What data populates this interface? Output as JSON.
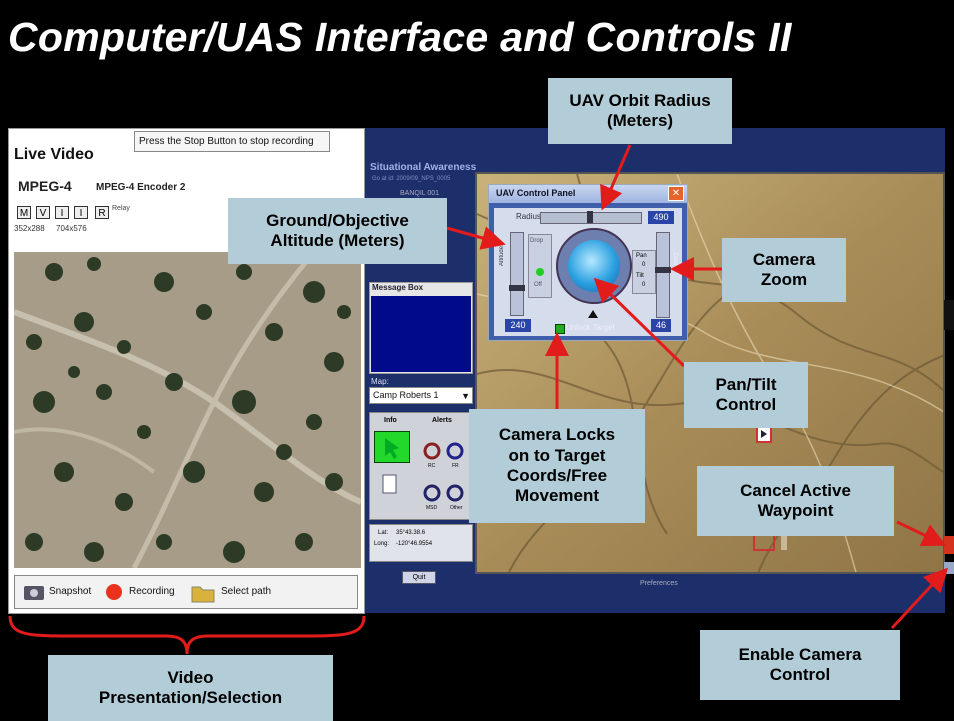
{
  "slide": {
    "title": "Computer/UAS Interface and Controls II"
  },
  "video_panel": {
    "tooltip": "Press the Stop Button to stop recording",
    "title": "Live Video",
    "codec": "MPEG-4",
    "encoder": "MPEG-4 Encoder 2",
    "mode_buttons": [
      "M",
      "V",
      "I",
      "I",
      "R"
    ],
    "relay_label": "Relay",
    "resolutions": [
      "352x288",
      "704x576"
    ],
    "controls": {
      "snapshot_label": "Snapshot",
      "recording_label": "Recording",
      "select_path_label": "Select path"
    }
  },
  "situational_awareness": {
    "title": "Situational Awareness",
    "subtitle": "Go at id: 2009/09_NPS_0005",
    "sub2": "BANQIL 001",
    "message_box_title": "Message Box",
    "map_label": "Map:",
    "map_selected": "Camp Roberts 1",
    "info_tab": "Info",
    "alerts_tab": "Alerts",
    "alert_labels": [
      "RC",
      "FR",
      "MSD",
      "Other"
    ],
    "lat_label": "Lat:",
    "lat_value": "35°43.38.6",
    "long_label": "Long:",
    "long_value": "-120°46.9554",
    "quit_label": "Quit",
    "preferences_label": "Preferences"
  },
  "uav_control_panel": {
    "title": "UAV Control Panel",
    "radius_label": "Radius",
    "radius_value": "490",
    "altitude_label": "Altitude",
    "altitude_value": "240",
    "drop_label": "Drop",
    "drop_state": "Off",
    "pan_label": "Pan",
    "tilt_label": "Tilt",
    "pan_value": "0",
    "tilt_value": "0",
    "zoom_label": "Zoom",
    "zoom_value": "46",
    "unlock_label": "Unlock Target"
  },
  "callouts": {
    "orbit_radius": [
      "UAV Orbit Radius",
      "(Meters)"
    ],
    "ground_altitude": [
      "Ground/Objective",
      "Altitude (Meters)"
    ],
    "camera_zoom": [
      "Camera",
      "Zoom"
    ],
    "pan_tilt": [
      "Pan/Tilt",
      "Control"
    ],
    "camera_locks": [
      "Camera Locks",
      "on to Target",
      "Coords/Free",
      "Movement"
    ],
    "cancel_waypoint": [
      "Cancel Active",
      "Waypoint"
    ],
    "enable_camera": [
      "Enable Camera",
      "Control"
    ],
    "video_presentation": [
      "Video",
      "Presentation/Selection"
    ]
  },
  "colors": {
    "callout_bg": "#b3cdd8",
    "arrow": "#e21b1b",
    "panel_blue": "#3f5faa",
    "message_area": "#000a8a"
  }
}
